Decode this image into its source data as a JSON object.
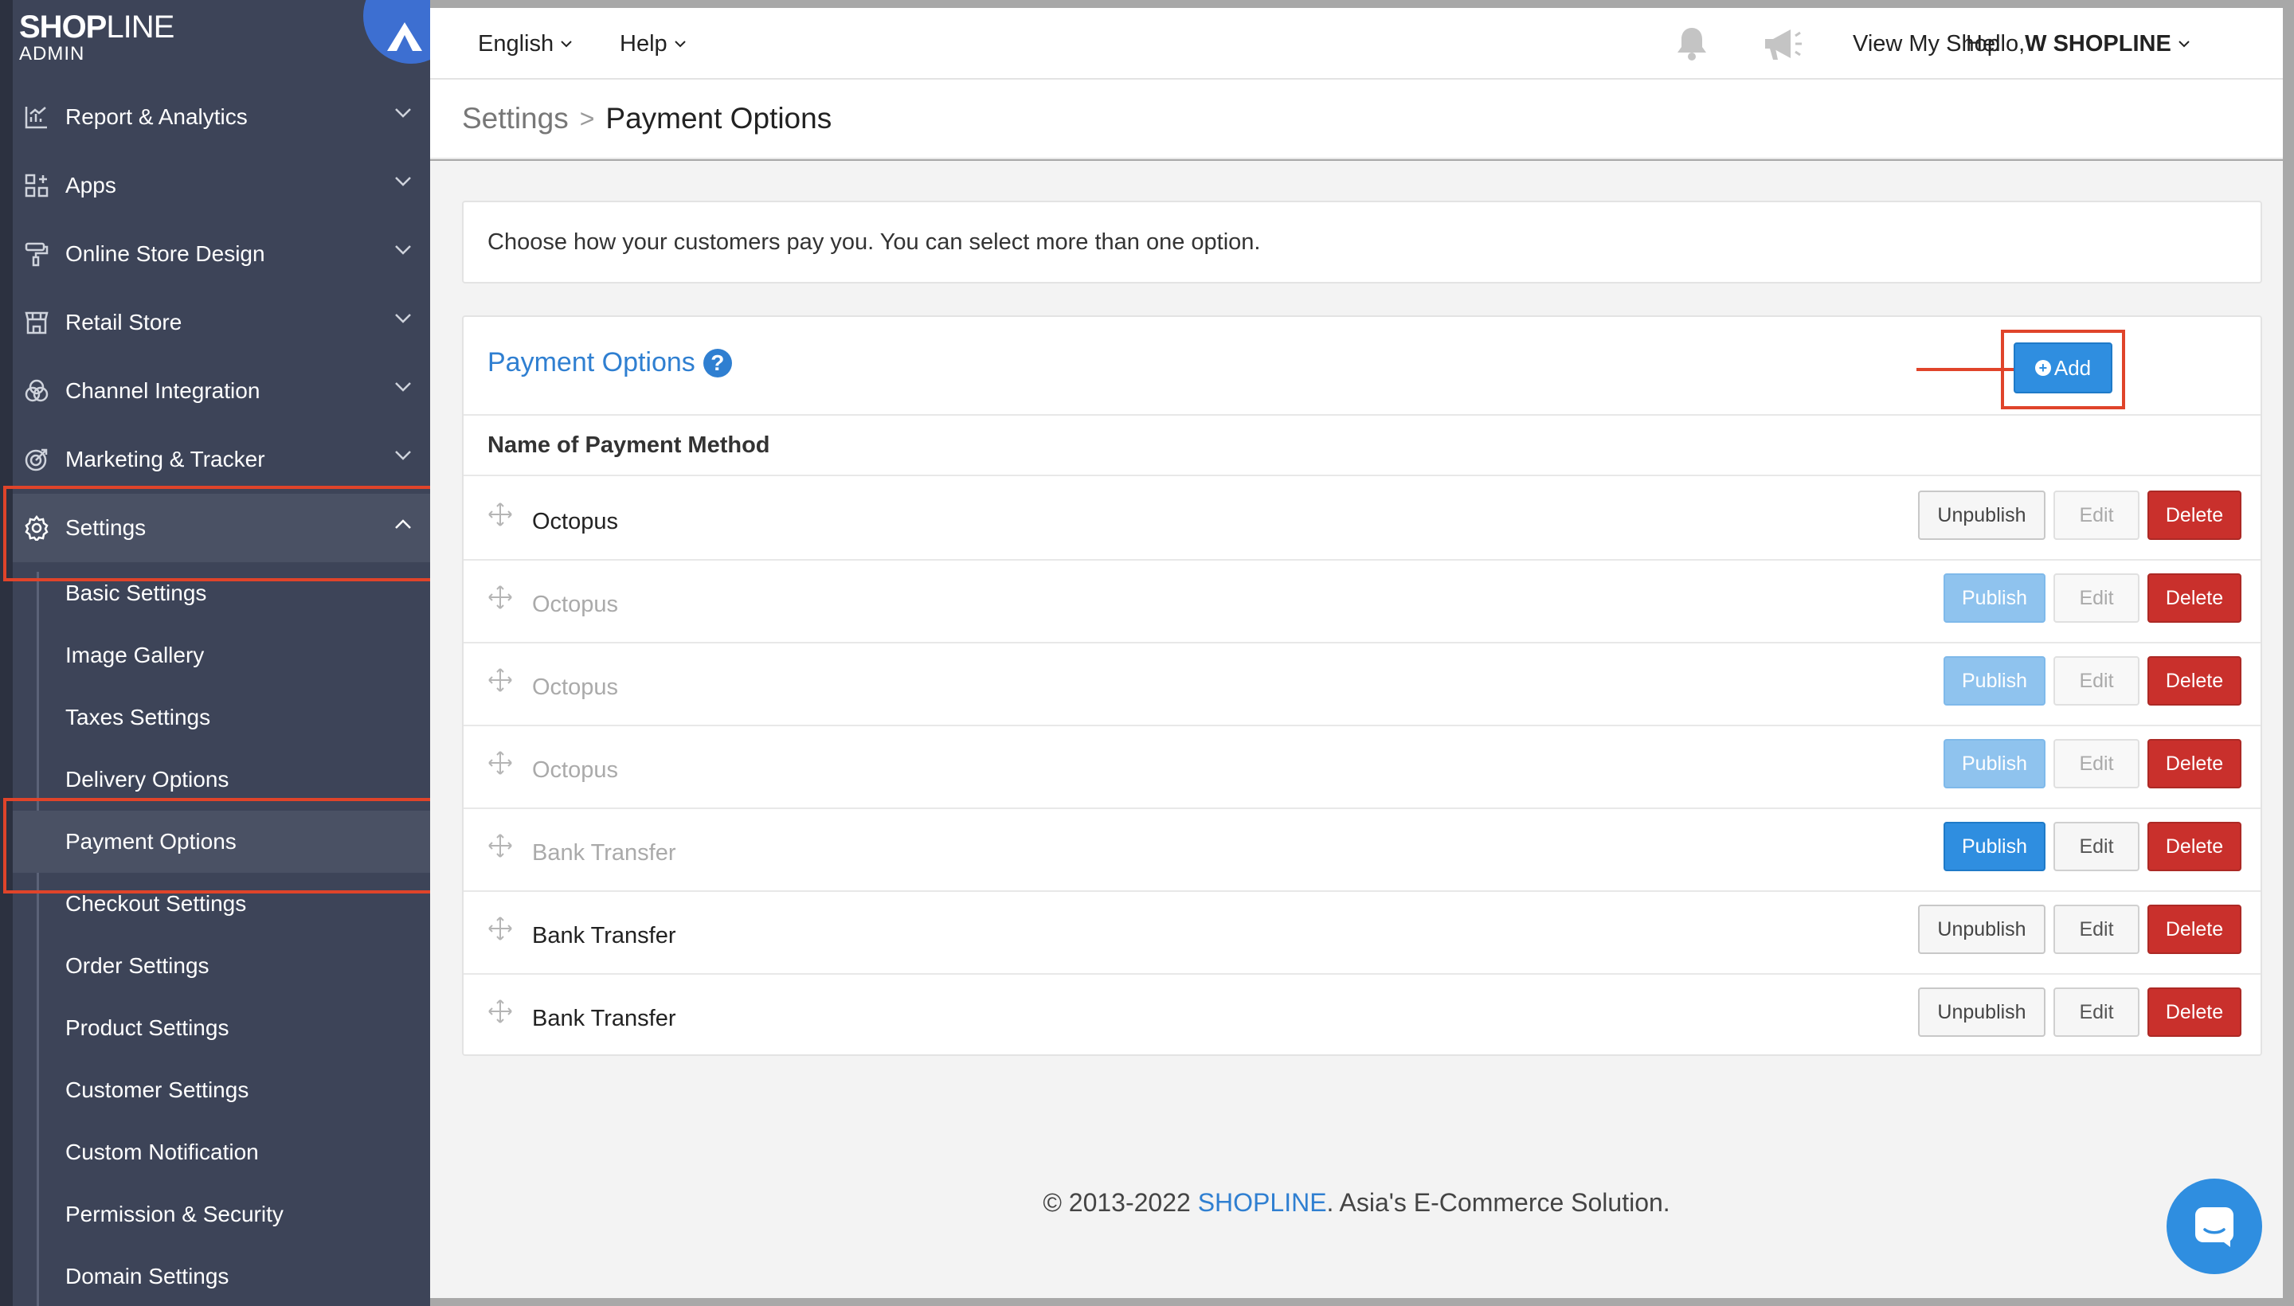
{
  "logo": {
    "brand_bold": "SHOP",
    "brand_thin": "LINE",
    "sub": "ADMIN"
  },
  "sidebar": {
    "items": [
      {
        "label": "Report & Analytics",
        "icon": "chart-icon"
      },
      {
        "label": "Apps",
        "icon": "apps-grid-icon"
      },
      {
        "label": "Online Store Design",
        "icon": "paint-roller-icon"
      },
      {
        "label": "Retail Store",
        "icon": "store-icon"
      },
      {
        "label": "Channel Integration",
        "icon": "channels-icon"
      },
      {
        "label": "Marketing & Tracker",
        "icon": "target-icon"
      },
      {
        "label": "Settings",
        "icon": "gear-icon"
      }
    ],
    "settings_sub": [
      "Basic Settings",
      "Image Gallery",
      "Taxes Settings",
      "Delivery Options",
      "Payment Options",
      "Checkout Settings",
      "Order Settings",
      "Product Settings",
      "Customer Settings",
      "Custom Notification",
      "Permission & Security",
      "Domain Settings"
    ]
  },
  "topbar": {
    "language": "English",
    "help": "Help",
    "view_shop": "View My Shop",
    "greeting": "Hello, ",
    "user": "W SHOPLINE"
  },
  "breadcrumb": {
    "root": "Settings",
    "sep": ">",
    "current": "Payment Options"
  },
  "intro": "Choose how your customers pay you. You can select more than one option.",
  "panel": {
    "title": "Payment Options",
    "help": "?",
    "add_label": "Add",
    "column_header": "Name of Payment Method"
  },
  "buttons": {
    "unpublish": "Unpublish",
    "publish": "Publish",
    "edit": "Edit",
    "delete": "Delete"
  },
  "rows": [
    {
      "name": "Octopus"
    },
    {
      "name": "Octopus"
    },
    {
      "name": "Octopus"
    },
    {
      "name": "Octopus"
    },
    {
      "name": "Bank Transfer"
    },
    {
      "name": "Bank Transfer"
    },
    {
      "name": "Bank Transfer"
    }
  ],
  "footer": {
    "prefix": "© 2013-2022 ",
    "brand": "SHOPLINE",
    "suffix": ". Asia's E-Commerce Solution."
  }
}
